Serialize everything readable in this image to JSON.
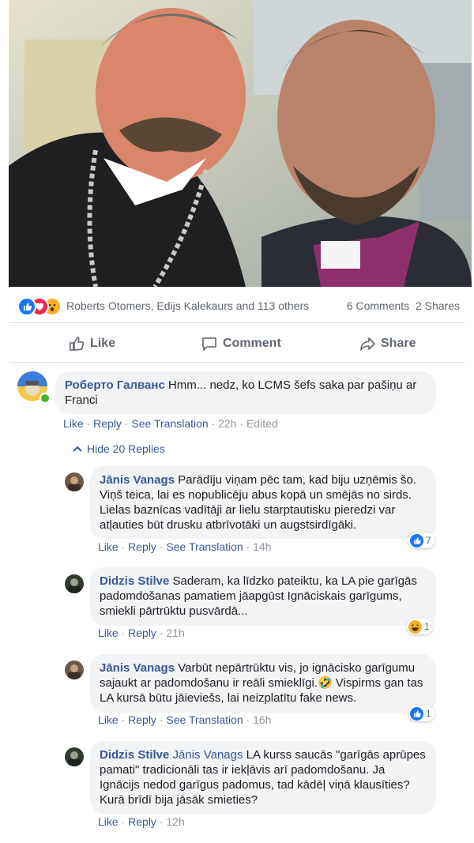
{
  "post": {
    "reactions": {
      "names": "Roberts Otomers, Edijs Kalekaurs and 113 others",
      "comments": "6 Comments",
      "shares": "2 Shares",
      "icons": [
        "like-icon",
        "love-icon",
        "wow-icon"
      ],
      "colors": {
        "like": "#1877f2",
        "love": "#f02849",
        "wow": "#f7b125"
      }
    },
    "actions": {
      "like": "Like",
      "comment": "Comment",
      "share": "Share"
    }
  },
  "comments": {
    "top": {
      "author": "Роберто Галванс",
      "text": "Hmm... nedz, ko LCMS šefs saka par pašiņu ar Franci",
      "like": "Like",
      "reply": "Reply",
      "see_translation": "See Translation",
      "time": "22h",
      "edited": "Edited"
    },
    "hide_replies": "Hide 20 Replies",
    "replies": [
      {
        "author": "Jānis Vanags",
        "text": "Parādīju viņam pēc tam, kad biju uzņēmis šo. Viņš teica, lai es nopublicēju abus kopā un smējās no sirds. Lielas baznīcas vadītāji ar lielu starptautisku pieredzi var atļauties būt drusku atbrīvotāki un augstsirdīgāki.",
        "like": "Like",
        "reply": "Reply",
        "see_translation": "See Translation",
        "time": "14h",
        "reaction_icon": "like-icon",
        "reaction_count": "7"
      },
      {
        "author": "Didzis Stilve",
        "text": "Saderam, ka līdzko pateiktu, ka LA pie garīgās padomdošanas pamatiem jāapgūst Ignāciskais garīgums, smiekli pārtrūktu pusvārdā...",
        "like": "Like",
        "reply": "Reply",
        "time": "21h",
        "reaction_icon": "haha-icon",
        "reaction_count": "1"
      },
      {
        "author": "Jānis Vanags",
        "text": "Varbūt nepārtrūktu vis, jo ignācisko garīgumu sajaukt ar padomdošanu ir reāli smieklīgi.🤣 Vispirms gan tas LA kursā būtu jāieviešs, lai neizplatītu fake news.",
        "like": "Like",
        "reply": "Reply",
        "see_translation": "See Translation",
        "time": "16h",
        "reaction_icon": "like-icon",
        "reaction_count": "1"
      },
      {
        "author": "Didzis Stilve",
        "mention": "Jānis Vanags",
        "text": "LA kurss saucās \"garīgās aprūpes pamati\" tradicionāli tas ir iekļāvis arī padomdošanu. Ja Ignācijs nedod garīgus padomus, tad kādēļ viņā klausīties? Kurā brīdī bija jāsāk smieties?",
        "like": "Like",
        "reply": "Reply",
        "time": "12h"
      }
    ]
  }
}
